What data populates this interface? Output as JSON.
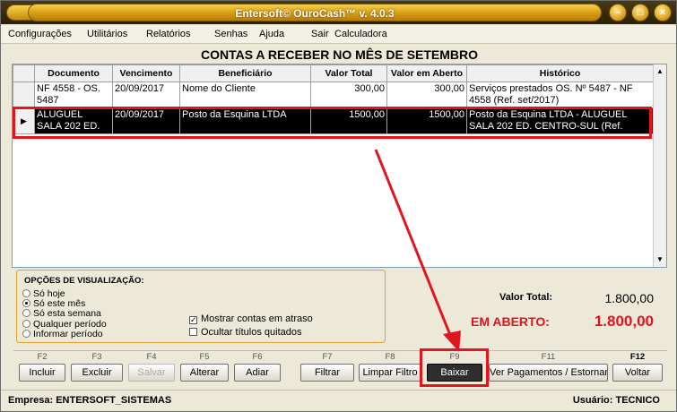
{
  "window": {
    "title": "Entersoft© OuroCash™ v. 4.0.3"
  },
  "menu": [
    "Configurações",
    "Utilitários",
    "Relatórios",
    "Senhas",
    "Ajuda",
    "Sair",
    "Calculadora"
  ],
  "header": "CONTAS A RECEBER NO MÊS DE SETEMBRO",
  "table": {
    "columns": [
      "Documento",
      "Vencimento",
      "Beneficiário",
      "Valor Total",
      "Valor em Aberto",
      "Histórico"
    ],
    "rows": [
      [
        "NF 4558 - OS. 5487",
        "20/09/2017",
        "Nome do Cliente",
        "300,00",
        "300,00",
        "Serviços prestados OS. Nº 5487 - NF 4558 (Ref. set/2017)"
      ],
      [
        "ALUGUEL SALA 202 ED.",
        "20/09/2017",
        "Posto da Esquina LTDA",
        "1500,00",
        "1500,00",
        "Posto da Esquina LTDA - ALUGUEL SALA 202 ED. CENTRO-SUL (Ref."
      ]
    ]
  },
  "options": {
    "label": "OPÇÕES DE VISUALIZAÇÃO:",
    "radios": [
      "Só hoje",
      "Só este mês",
      "Só esta semana",
      "Qualquer período",
      "Informar período"
    ],
    "selected": "Só este mês",
    "checks": [
      {
        "label": "Mostrar contas em atraso",
        "checked": true
      },
      {
        "label": "Ocultar títulos quitados",
        "checked": false
      }
    ]
  },
  "totals": {
    "total_label": "Valor Total:",
    "total_value": "1.800,00",
    "open_label": "EM ABERTO:",
    "open_value": "1.800,00",
    "open_color": "#e2141e"
  },
  "buttons": [
    {
      "key": "F2",
      "label": "Incluir"
    },
    {
      "key": "F3",
      "label": "Excluir"
    },
    {
      "key": "F4",
      "label": "Salvar"
    },
    {
      "key": "F5",
      "label": "Alterar"
    },
    {
      "key": "F6",
      "label": "Adiar"
    },
    {
      "key": "F7",
      "label": "Filtrar"
    },
    {
      "key": "F8",
      "label": "Limpar Filtro"
    },
    {
      "key": "F9",
      "label": "Baixar"
    },
    {
      "key": "F11",
      "label": "Ver Pagamentos / Estornar"
    },
    {
      "key": "F12",
      "label": "Voltar"
    }
  ],
  "status": {
    "company": "Empresa: ENTERSOFT_SISTEMAS",
    "user": "Usuário: TECNICO"
  },
  "icons": {
    "row_pointer": "row-pointer-icon",
    "title_buttons": [
      "minimize-icon",
      "maximize-icon",
      "close-icon"
    ]
  },
  "colors": {
    "highlight": "#e2141e",
    "title_gold": "#d89b12"
  }
}
